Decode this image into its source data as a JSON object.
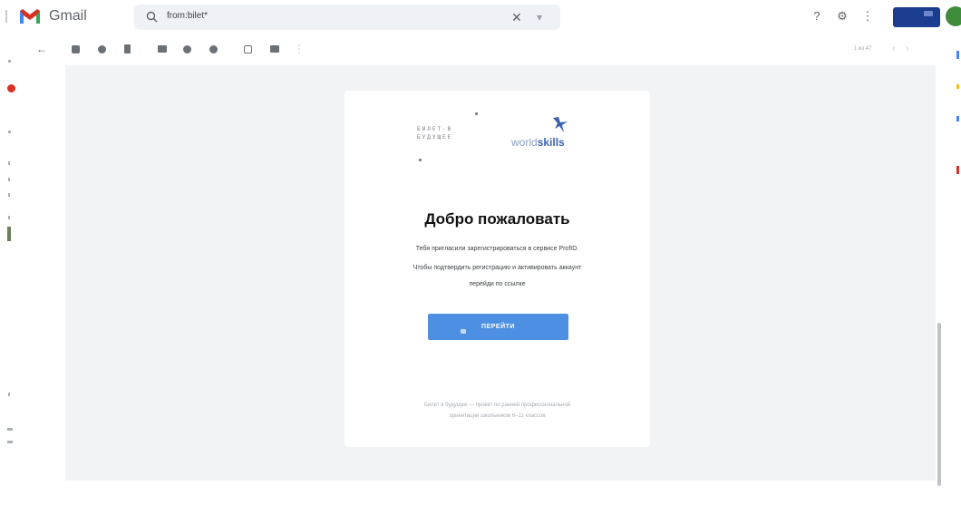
{
  "app": {
    "name": "Gmail"
  },
  "search": {
    "query": "from:bilet*"
  },
  "toolbar": {
    "pager_text": "1 из 47"
  },
  "email": {
    "logos": {
      "bilet_line1": "БИЛЕТ·В",
      "bilet_line2": "БУДУЩЕЕ",
      "worldskills_prefix": "world",
      "worldskills_suffix": "skills"
    },
    "title": "Добро пожаловать",
    "body_lines": [
      "Тебя пригласили зарегистрироваться в сервисе ProfID.",
      "Чтобы подтвердить регистрацию и активировать аккаунт",
      "перейди по ссылке"
    ],
    "cta_label": "ПЕРЕЙТИ",
    "footer_lines": [
      "Билет в будущее — проект по ранней профессиональной",
      "ориентации школьников 6–11 классов"
    ]
  },
  "colors": {
    "accent": "#4d8fe3",
    "content_bg": "#f1f3f4",
    "worldskills_blue": "#3b63b0"
  },
  "icons": {
    "back": "arrow-left-icon",
    "archive": "archive-icon",
    "spam": "report-spam-icon",
    "delete": "trash-icon",
    "mark_unread": "envelope-icon",
    "snooze": "clock-icon",
    "add_task": "task-icon",
    "move": "folder-move-icon",
    "label": "label-icon",
    "more": "more-vert-icon",
    "help": "help-icon",
    "settings": "gear-icon",
    "apps": "apps-grid-icon"
  }
}
